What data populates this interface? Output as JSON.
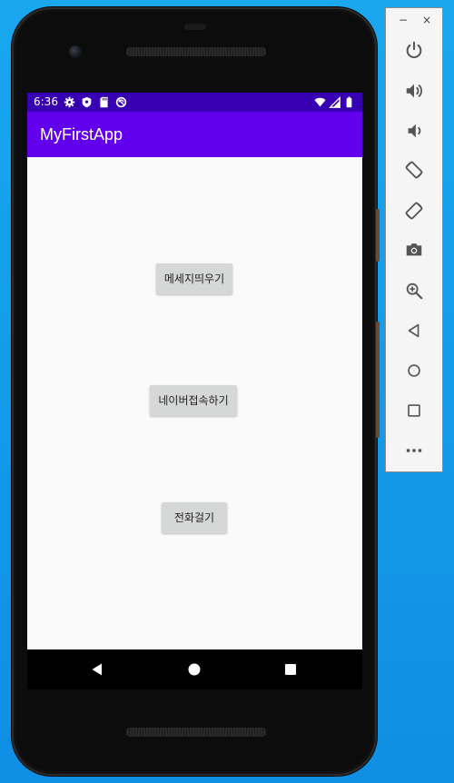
{
  "status_bar": {
    "time": "6:36",
    "left_icons": [
      "settings-gear-icon",
      "shield-icon",
      "sd-card-icon",
      "sync-circle-icon"
    ],
    "right_icons": [
      "wifi-icon",
      "cell-signal-icon",
      "battery-icon"
    ]
  },
  "app": {
    "title": "MyFirstApp",
    "buttons": [
      {
        "label": "메세지띄우기"
      },
      {
        "label": "네이버접속하기"
      },
      {
        "label": "전화걸기"
      }
    ]
  },
  "nav": {
    "back_icon": "back-triangle-icon",
    "home_icon": "home-circle-icon",
    "recents_icon": "recents-square-icon"
  },
  "emulator_toolbar": {
    "minimize_label": "−",
    "close_label": "×",
    "tools": [
      "power-icon",
      "volume-up-icon",
      "volume-down-icon",
      "rotate-left-icon",
      "rotate-right-icon",
      "camera-icon",
      "zoom-icon",
      "back-icon",
      "home-icon",
      "overview-icon",
      "more-icon"
    ]
  },
  "colors": {
    "status_bar": "#3700b3",
    "app_bar": "#6200ee",
    "button_bg": "#d6d7d7",
    "desktop": "#19a7ee"
  }
}
